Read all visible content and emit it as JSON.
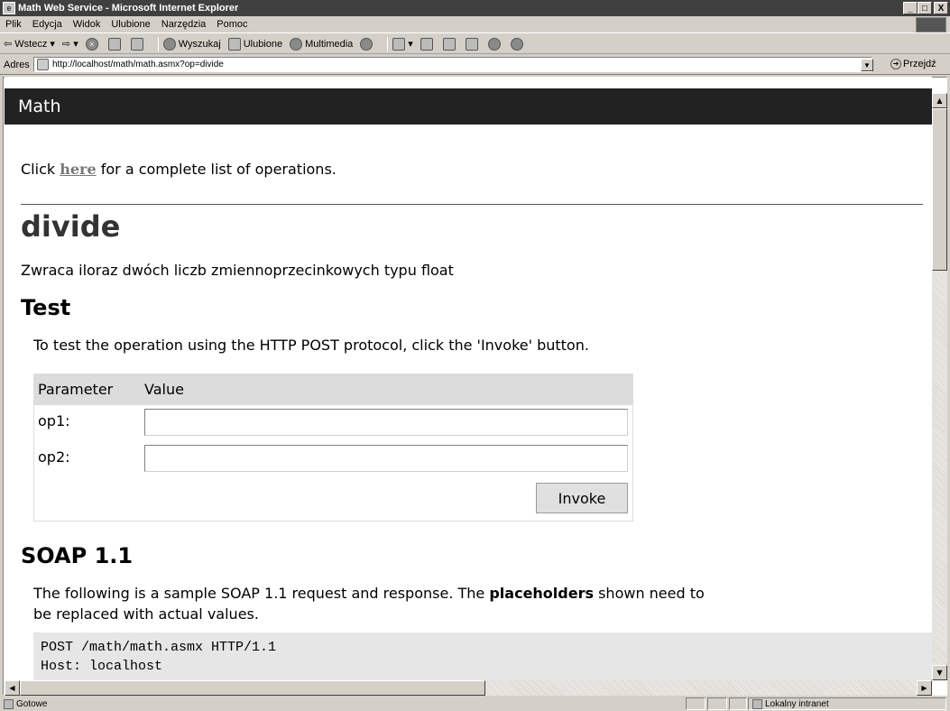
{
  "window": {
    "title": "Math Web Service - Microsoft Internet Explorer",
    "minimize": "_",
    "maximize": "□",
    "close": "X"
  },
  "menu": [
    "Plik",
    "Edycja",
    "Widok",
    "Ulubione",
    "Narzędzia",
    "Pomoc"
  ],
  "toolbar": {
    "back": "Wstecz",
    "search": "Wyszukaj",
    "favorites": "Ulubione",
    "media": "Multimedia"
  },
  "address": {
    "label": "Adres",
    "url": "http://localhost/math/math.asmx?op=divide",
    "go": "Przejdź"
  },
  "page": {
    "service_name": "Math",
    "click_prefix": "Click ",
    "here_link": "here",
    "click_suffix": " for a complete list of operations.",
    "operation": "divide",
    "operation_desc": "Zwraca iloraz dwóch liczb zmiennoprzecinkowych typu float",
    "test_heading": "Test",
    "test_text": "To test the operation using the HTTP POST protocol, click the 'Invoke' button.",
    "table": {
      "col_param": "Parameter",
      "col_value": "Value",
      "param1": "op1:",
      "param1_value": "",
      "param2": "op2:",
      "param2_value": ""
    },
    "invoke": "Invoke",
    "soap_heading": "SOAP 1.1",
    "soap_text_1": "The following is a sample SOAP 1.1 request and response. The ",
    "soap_text_bold": "placeholders",
    "soap_text_2": " shown need to",
    "soap_text_3": "be replaced with actual values.",
    "code": "POST /math/math.asmx HTTP/1.1\nHost: localhost"
  },
  "status": {
    "text": "Gotowe",
    "zone": "Lokalny intranet"
  }
}
